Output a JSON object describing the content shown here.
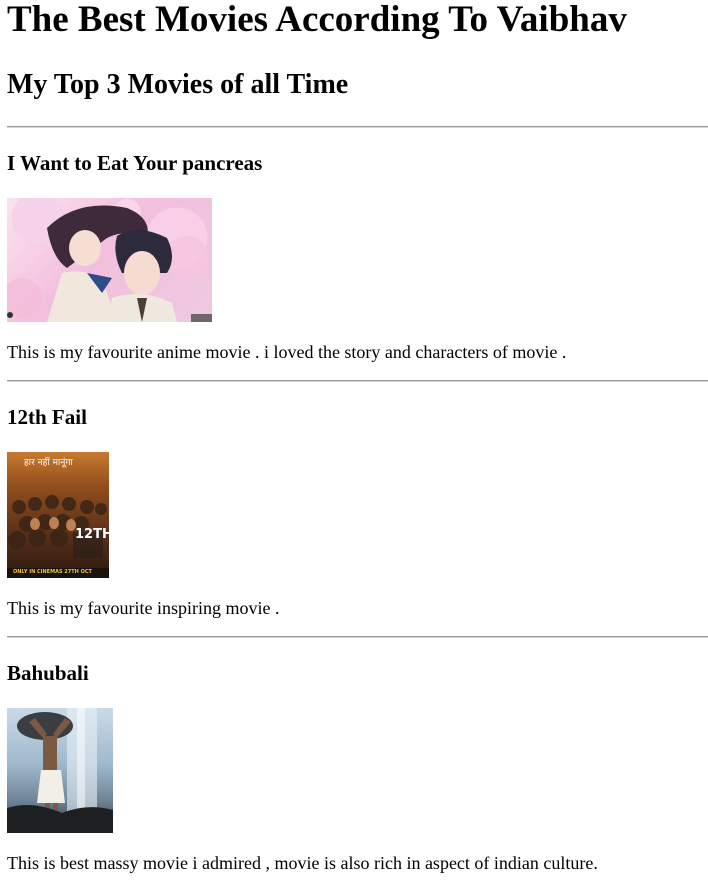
{
  "page": {
    "title": "The Best Movies According To Vaibhav",
    "subtitle": "My Top 3 Movies of all Time"
  },
  "movies": [
    {
      "title": "I Want to Eat Your pancreas",
      "description": "This is my favourite anime movie . i loved the story and characters of movie ."
    },
    {
      "title": "12th Fail",
      "description": "This is my favourite inspiring movie .",
      "poster_text": {
        "tagline": "हार नहीं मानूंगा",
        "title_mark": "12TH",
        "release": "ONLY IN CINEMAS 27TH OCT"
      }
    },
    {
      "title": "Bahubali",
      "description": "This is best massy movie i admired , movie is also rich in aspect of indian culture."
    }
  ]
}
